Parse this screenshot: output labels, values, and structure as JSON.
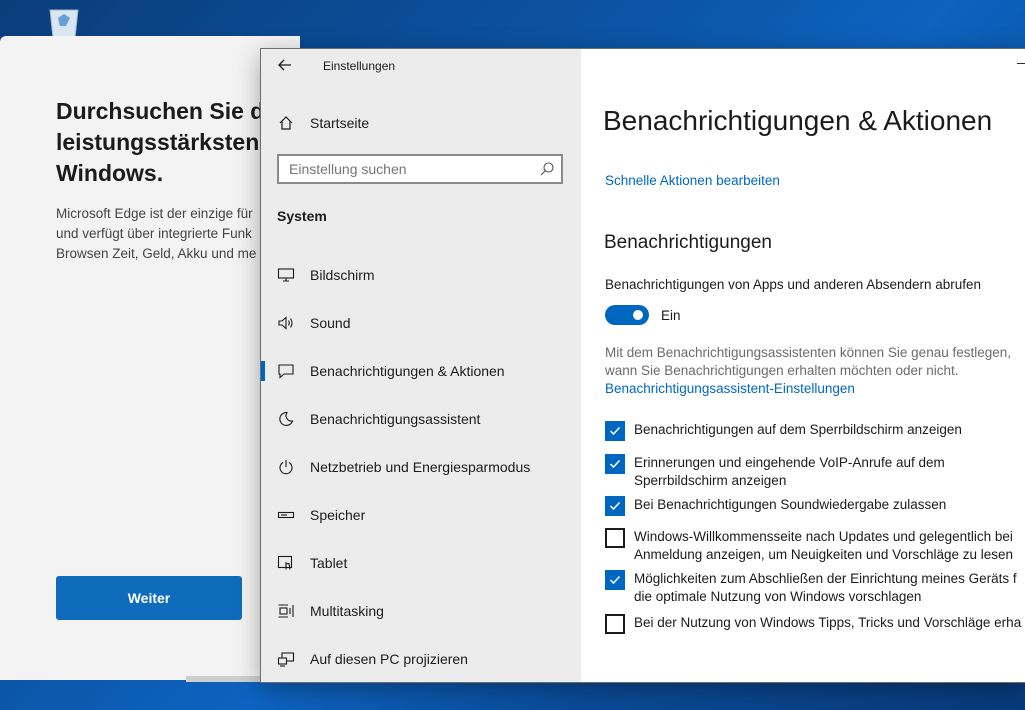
{
  "desktop": {
    "recycle_bin_icon": "recycle-bin-icon"
  },
  "edge_dialog": {
    "title": "Durchsuchen Sie da\nleistungsstärksten \nWindows.",
    "description": "Microsoft Edge ist der einzige für\nund verfügt über integrierte Funk\nBrowsen Zeit, Geld, Akku und me",
    "continue_label": "Weiter",
    "accent": "#0f6cbd"
  },
  "settings": {
    "window_title": "Einstellungen",
    "home_label": "Startseite",
    "search_placeholder": "Einstellung suchen",
    "section": "System",
    "nav_items": [
      {
        "label": "Bildschirm",
        "icon": "monitor-icon"
      },
      {
        "label": "Sound",
        "icon": "speaker-icon"
      },
      {
        "label": "Benachrichtigungen & Aktionen",
        "icon": "notification-icon",
        "selected": true
      },
      {
        "label": "Benachrichtigungsassistent",
        "icon": "moon-icon"
      },
      {
        "label": "Netzbetrieb und Energiesparmodus",
        "icon": "power-icon"
      },
      {
        "label": "Speicher",
        "icon": "storage-icon"
      },
      {
        "label": "Tablet",
        "icon": "tablet-icon"
      },
      {
        "label": "Multitasking",
        "icon": "multitasking-icon"
      },
      {
        "label": "Auf diesen PC projizieren",
        "icon": "project-icon"
      }
    ],
    "accent": "#0067c0"
  },
  "content": {
    "page_title": "Benachrichtigungen & Aktionen",
    "quick_actions_link": "Schnelle Aktionen bearbeiten",
    "notifications_heading": "Benachrichtigungen",
    "toggle_label": "Benachrichtigungen von Apps und anderen Absendern abrufen",
    "toggle_on": true,
    "toggle_state": "Ein",
    "assist_description": "Mit dem Benachrichtigungsassistenten können Sie genau festlegen,\nwann Sie Benachrichtigungen erhalten möchten oder nicht.",
    "assist_link": "Benachrichtigungsassistent-Einstellungen",
    "checkboxes": [
      {
        "label": "Benachrichtigungen auf dem Sperrbildschirm anzeigen",
        "checked": true
      },
      {
        "label": "Erinnerungen und eingehende VoIP-Anrufe auf dem\nSperrbildschirm anzeigen",
        "checked": true
      },
      {
        "label": "Bei Benachrichtigungen Soundwiedergabe zulassen",
        "checked": true
      },
      {
        "label": "Windows-Willkommensseite nach Updates und gelegentlich bei\nAnmeldung anzeigen, um Neuigkeiten und Vorschläge zu lesen",
        "checked": false
      },
      {
        "label": "Möglichkeiten zum Abschließen der Einrichtung meines Geräts f\ndie optimale Nutzung von Windows vorschlagen",
        "checked": true
      },
      {
        "label": "Bei der Nutzung von Windows Tipps, Tricks und Vorschläge erha",
        "checked": false
      }
    ]
  }
}
